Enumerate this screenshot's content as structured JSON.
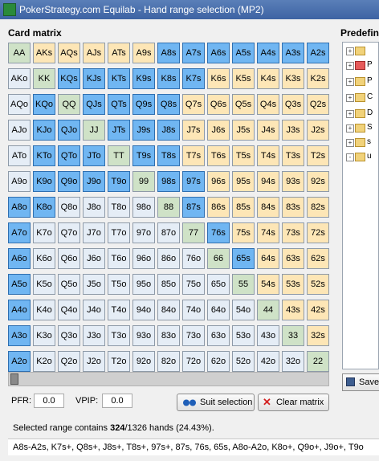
{
  "window": {
    "title": "PokerStrategy.com Equilab - Hand range selection (MP2)"
  },
  "matrix": {
    "label": "Card matrix",
    "rows": [
      [
        "AA",
        "AKs",
        "AQs",
        "AJs",
        "ATs",
        "A9s",
        "A8s",
        "A7s",
        "A6s",
        "A5s",
        "A4s",
        "A3s",
        "A2s"
      ],
      [
        "AKo",
        "KK",
        "KQs",
        "KJs",
        "KTs",
        "K9s",
        "K8s",
        "K7s",
        "K6s",
        "K5s",
        "K4s",
        "K3s",
        "K2s"
      ],
      [
        "AQo",
        "KQo",
        "QQ",
        "QJs",
        "QTs",
        "Q9s",
        "Q8s",
        "Q7s",
        "Q6s",
        "Q5s",
        "Q4s",
        "Q3s",
        "Q2s"
      ],
      [
        "AJo",
        "KJo",
        "QJo",
        "JJ",
        "JTs",
        "J9s",
        "J8s",
        "J7s",
        "J6s",
        "J5s",
        "J4s",
        "J3s",
        "J2s"
      ],
      [
        "ATo",
        "KTo",
        "QTo",
        "JTo",
        "TT",
        "T9s",
        "T8s",
        "T7s",
        "T6s",
        "T5s",
        "T4s",
        "T3s",
        "T2s"
      ],
      [
        "A9o",
        "K9o",
        "Q9o",
        "J9o",
        "T9o",
        "99",
        "98s",
        "97s",
        "96s",
        "95s",
        "94s",
        "93s",
        "92s"
      ],
      [
        "A8o",
        "K8o",
        "Q8o",
        "J8o",
        "T8o",
        "98o",
        "88",
        "87s",
        "86s",
        "85s",
        "84s",
        "83s",
        "82s"
      ],
      [
        "A7o",
        "K7o",
        "Q7o",
        "J7o",
        "T7o",
        "97o",
        "87o",
        "77",
        "76s",
        "75s",
        "74s",
        "73s",
        "72s"
      ],
      [
        "A6o",
        "K6o",
        "Q6o",
        "J6o",
        "T6o",
        "96o",
        "86o",
        "76o",
        "66",
        "65s",
        "64s",
        "63s",
        "62s"
      ],
      [
        "A5o",
        "K5o",
        "Q5o",
        "J5o",
        "T5o",
        "95o",
        "85o",
        "75o",
        "65o",
        "55",
        "54s",
        "53s",
        "52s"
      ],
      [
        "A4o",
        "K4o",
        "Q4o",
        "J4o",
        "T4o",
        "94o",
        "84o",
        "74o",
        "64o",
        "54o",
        "44",
        "43s",
        "42s"
      ],
      [
        "A3o",
        "K3o",
        "Q3o",
        "J3o",
        "T3o",
        "93o",
        "83o",
        "73o",
        "63o",
        "53o",
        "43o",
        "33",
        "32s"
      ],
      [
        "A2o",
        "K2o",
        "Q2o",
        "J2o",
        "T2o",
        "92o",
        "82o",
        "72o",
        "62o",
        "52o",
        "42o",
        "32o",
        "22"
      ]
    ],
    "selected": [
      "A8s",
      "A7s",
      "A6s",
      "A5s",
      "A4s",
      "A3s",
      "A2s",
      "KQs",
      "KJs",
      "KTs",
      "K9s",
      "K8s",
      "K7s",
      "QJs",
      "QTs",
      "Q9s",
      "Q8s",
      "JTs",
      "J9s",
      "J8s",
      "T9s",
      "T8s",
      "98s",
      "97s",
      "87s",
      "76s",
      "65s",
      "KQo",
      "QJo",
      "KJo",
      "KTo",
      "QTo",
      "JTo",
      "K9o",
      "Q9o",
      "J9o",
      "T9o",
      "A8o",
      "A7o",
      "A6o",
      "A5o",
      "A4o",
      "A3o",
      "A2o",
      "K8o"
    ]
  },
  "predefined": {
    "label": "Predefin",
    "items": [
      "",
      "P",
      "P",
      "C",
      "D",
      "S",
      "s",
      "u"
    ]
  },
  "stats": {
    "pfr_label": "PFR:",
    "pfr_value": "0.0",
    "vpip_label": "VPIP:",
    "vpip_value": "0.0"
  },
  "buttons": {
    "suit_selection": "Suit selection",
    "clear_matrix": "Clear matrix",
    "save": "Save"
  },
  "summary": {
    "prefix": "Selected range contains ",
    "count": "324",
    "suffix": "/1326 hands (24.43%)."
  },
  "range_text": "A8s-A2s, K7s+, Q8s+, J8s+, T8s+, 97s+, 87s, 76s, 65s, A8o-A2o, K8o+, Q9o+, J9o+, T9o",
  "colors": {
    "selected": "#70b6f2",
    "suited": "#fde6b6",
    "offsuit": "#e5edf6",
    "pair": "#cfe2c7"
  }
}
